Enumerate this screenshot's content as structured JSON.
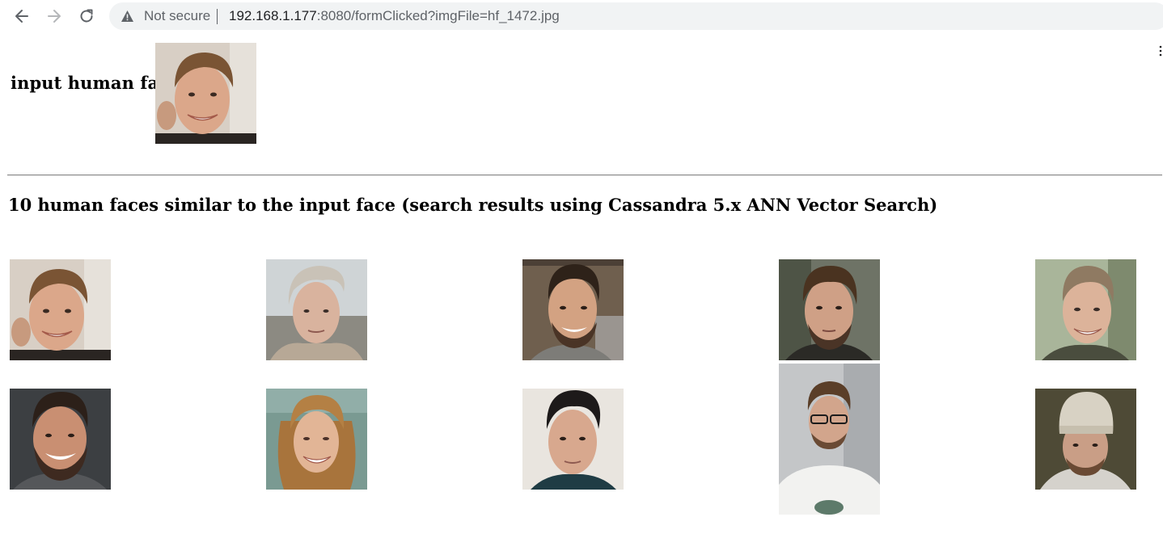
{
  "browser": {
    "security_label": "Not secure",
    "url_host": "192.168.1.177",
    "url_rest": ":8080/formClicked?imgFile=hf_1472.jpg",
    "icons": [
      "back-arrow-icon",
      "forward-arrow-icon",
      "reload-icon",
      "warning-triangle-icon",
      "menu-kebab-icon"
    ]
  },
  "page": {
    "input_label": "input human face",
    "results_heading": "10 human faces similar to the input face (search results using Cassandra 5.x ANN Vector Search)"
  },
  "colors": {
    "omnibox_bg": "#f1f3f4",
    "text_primary": "#202124",
    "text_secondary": "#5f6368",
    "rule": "#8a8a8a"
  }
}
